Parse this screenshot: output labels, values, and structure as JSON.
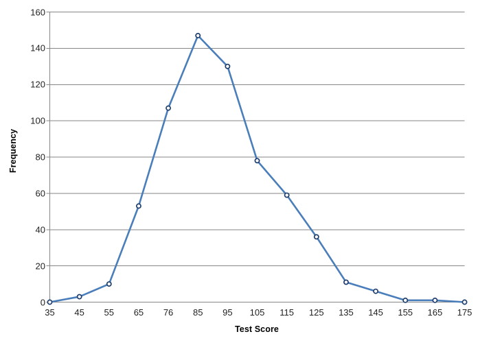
{
  "chart_data": {
    "type": "line",
    "title": "",
    "xlabel": "Test Score",
    "ylabel": "Frequency",
    "x": [
      35,
      45,
      55,
      65,
      76,
      85,
      95,
      105,
      115,
      125,
      135,
      145,
      155,
      165,
      175
    ],
    "categories": [
      "35",
      "45",
      "55",
      "65",
      "76",
      "85",
      "95",
      "105",
      "115",
      "125",
      "135",
      "145",
      "155",
      "165",
      "175"
    ],
    "values": [
      0,
      3,
      10,
      53,
      107,
      147,
      130,
      78,
      59,
      36,
      11,
      6,
      1,
      1,
      0
    ],
    "series": [
      {
        "name": "Frequency",
        "values": [
          0,
          3,
          10,
          53,
          107,
          147,
          130,
          78,
          59,
          36,
          11,
          6,
          1,
          1,
          0
        ]
      }
    ],
    "ylim": [
      0,
      160
    ],
    "yticks": [
      0,
      20,
      40,
      60,
      80,
      100,
      120,
      140,
      160
    ],
    "ytick_labels": [
      "0",
      "20",
      "40",
      "60",
      "80",
      "100",
      "120",
      "140",
      "160"
    ],
    "grid": "horizontal",
    "legend": "none",
    "colors": {
      "line": "#4a7ebb",
      "marker_fill": "#ffffff",
      "marker_stroke": "#1f3f6e",
      "gridline": "#868686",
      "background": "#ffffff",
      "text": "#222222"
    },
    "marker_style": "open-circle"
  }
}
